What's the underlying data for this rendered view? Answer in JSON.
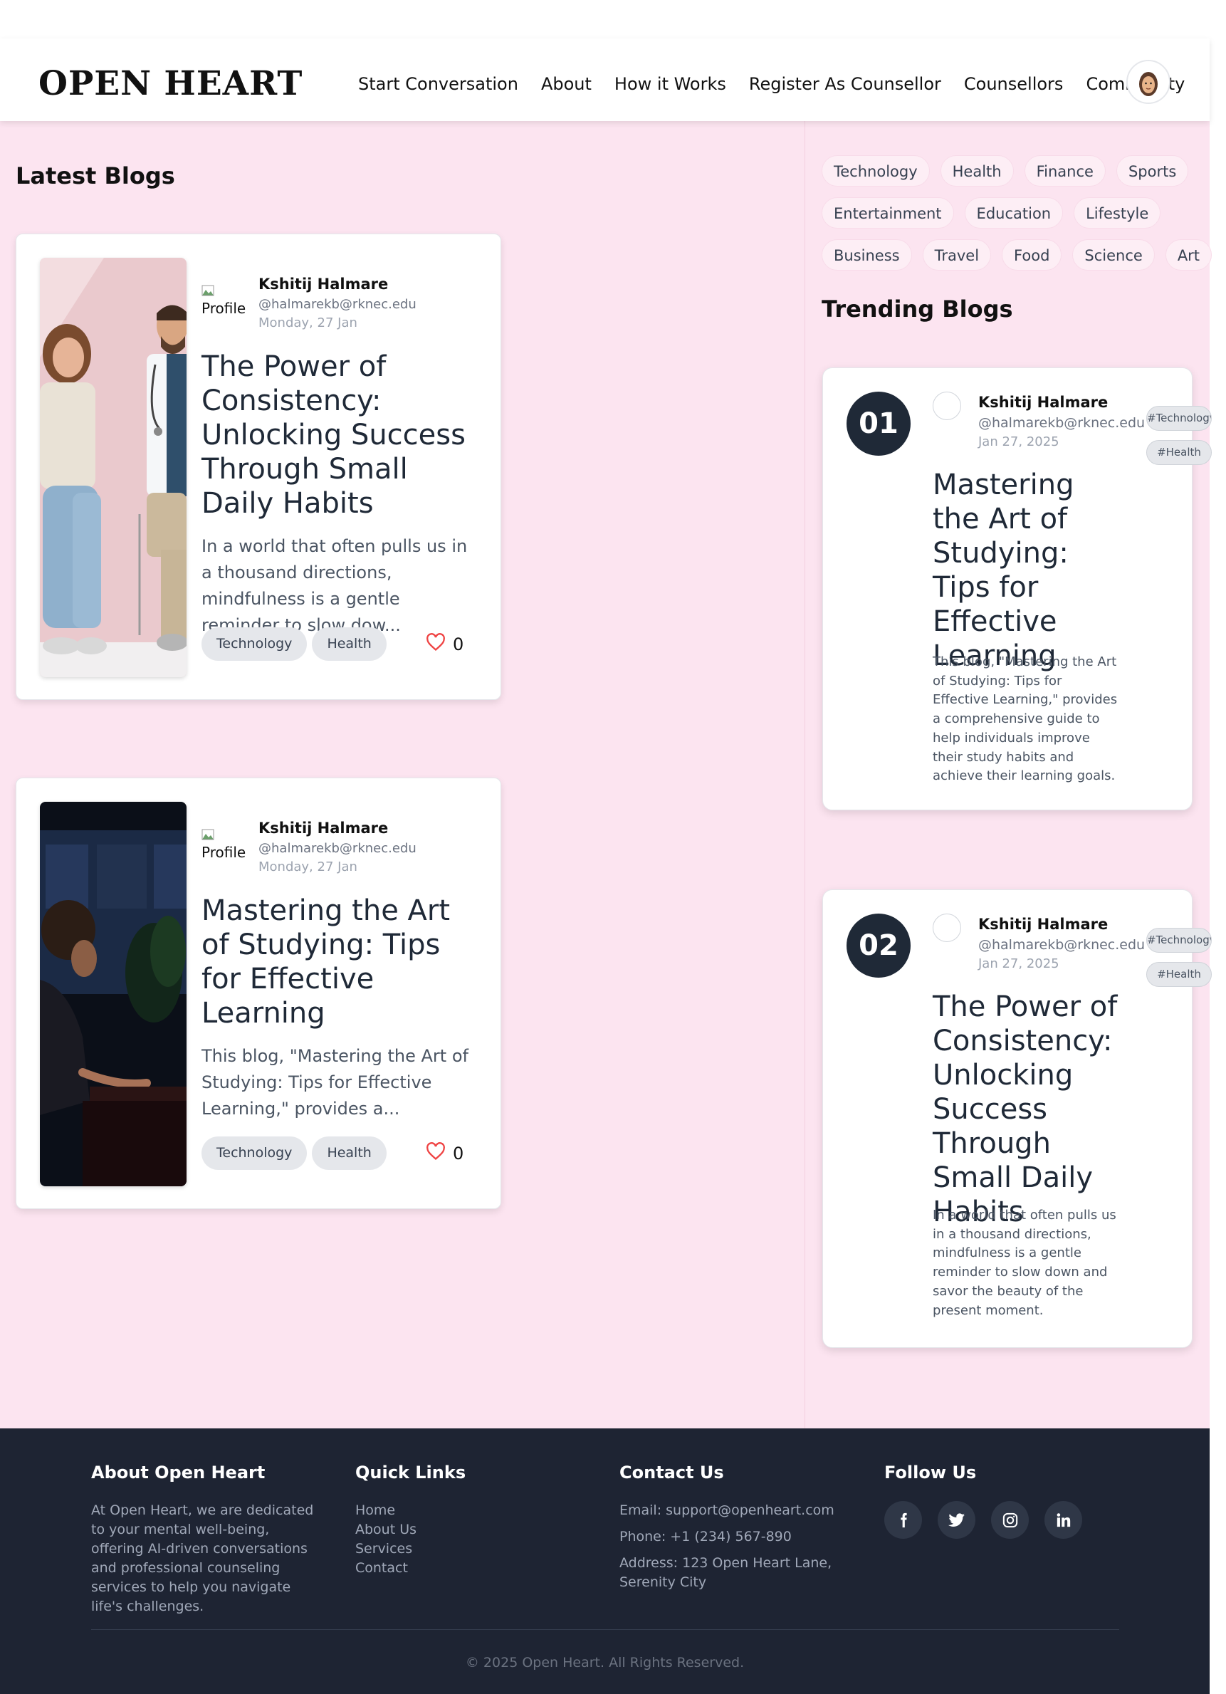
{
  "header": {
    "logo": "OPEN HEART",
    "nav": [
      "Start Conversation",
      "About",
      "How it Works",
      "Register As Counsellor",
      "Counsellors",
      "Community"
    ]
  },
  "latest": {
    "title": "Latest Blogs",
    "posts": [
      {
        "profile_alt": "Profile",
        "author": "Kshitij Halmare",
        "email": "@halmarekb@rknec.edu",
        "date": "Monday, 27 Jan",
        "title": "The Power of Consistency: Unlocking Success Through Small Daily Habits",
        "excerpt": "In a world that often pulls us in a thousand directions, mindfulness is a gentle reminder to slow dow...",
        "tags": [
          "Technology",
          "Health"
        ],
        "likes": "0"
      },
      {
        "profile_alt": "Profile",
        "author": "Kshitij Halmare",
        "email": "@halmarekb@rknec.edu",
        "date": "Monday, 27 Jan",
        "title": "Mastering the Art of Studying: Tips for Effective Learning",
        "excerpt": "This blog, \"Mastering the Art of Studying: Tips for Effective Learning,\" provides a...",
        "tags": [
          "Technology",
          "Health"
        ],
        "likes": "0"
      }
    ]
  },
  "categories": [
    [
      "Technology",
      "Health",
      "Finance",
      "Sports"
    ],
    [
      "Entertainment",
      "Education",
      "Lifestyle"
    ],
    [
      "Business",
      "Travel",
      "Food",
      "Science",
      "Art"
    ]
  ],
  "trending": {
    "title": "Trending Blogs",
    "posts": [
      {
        "rank": "01",
        "author": "Kshitij Halmare",
        "email": "@halmarekb@rknec.edu",
        "date": "Jan 27, 2025",
        "title": "Mastering the Art of Studying: Tips for Effective Learning",
        "desc": "This blog, \"Mastering the Art of Studying: Tips for Effective Learning,\" provides a comprehensive guide to help individuals improve their study habits and achieve their learning goals.",
        "tags": [
          "#Technology",
          "#Health"
        ]
      },
      {
        "rank": "02",
        "author": "Kshitij Halmare",
        "email": "@halmarekb@rknec.edu",
        "date": "Jan 27, 2025",
        "title": "The Power of Consistency: Unlocking Success Through Small Daily Habits",
        "desc": "In a world that often pulls us in a thousand directions, mindfulness is a gentle reminder to slow down and savor the beauty of the present moment.",
        "tags": [
          "#Technology",
          "#Health"
        ]
      }
    ]
  },
  "footer": {
    "about": {
      "title": "About Open Heart",
      "text": "At Open Heart, we are dedicated to your mental well-being, offering AI-driven conversations and professional counseling services to help you navigate life's challenges."
    },
    "quick_links": {
      "title": "Quick Links",
      "items": [
        "Home",
        "About Us",
        "Services",
        "Contact"
      ]
    },
    "contact": {
      "title": "Contact Us",
      "email": "Email: support@openheart.com",
      "phone": "Phone: +1 (234) 567-890",
      "address": "Address: 123 Open Heart Lane, Serenity City"
    },
    "follow": {
      "title": "Follow Us",
      "icons": [
        "facebook-icon",
        "twitter-icon",
        "instagram-icon",
        "linkedin-icon"
      ]
    },
    "copyright": "© 2025 Open Heart. All Rights Reserved."
  },
  "colors": {
    "page_bg": "#fce4f0",
    "footer_bg": "#1e2433",
    "dark": "#1f2937",
    "heart": "#ef4444"
  }
}
